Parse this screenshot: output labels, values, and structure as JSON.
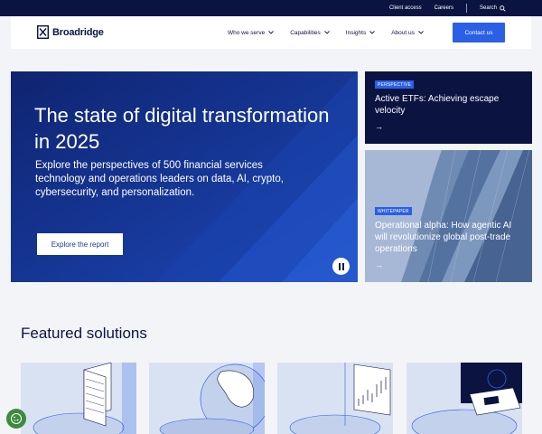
{
  "topbar": {
    "client_access": "Client access",
    "careers": "Careers",
    "search": "Search"
  },
  "header": {
    "logo_text": "Broadridge",
    "nav": [
      {
        "label": "Who we serve"
      },
      {
        "label": "Capabilities"
      },
      {
        "label": "Insights"
      },
      {
        "label": "About us"
      }
    ],
    "contact_label": "Contact us"
  },
  "hero": {
    "title": "The state of digital transformation in 2025",
    "description": "Explore the perspectives of 500 financial services technology and operations leaders on data, AI, crypto, cybersecurity, and personalization.",
    "button_label": "Explore the report"
  },
  "cards": [
    {
      "badge": "PERSPECTIVE",
      "title": "Active ETFs: Achieving escape velocity",
      "arrow": "→"
    },
    {
      "badge": "WHITEPAPER",
      "title": "Operational alpha: How agentic AI will revolutionize global post-trade operations",
      "arrow": "→"
    }
  ],
  "featured": {
    "heading": "Featured solutions"
  },
  "colors": {
    "navy": "#0b1441",
    "accent_blue": "#2a5fe6",
    "hero_blue": "#14328f"
  }
}
